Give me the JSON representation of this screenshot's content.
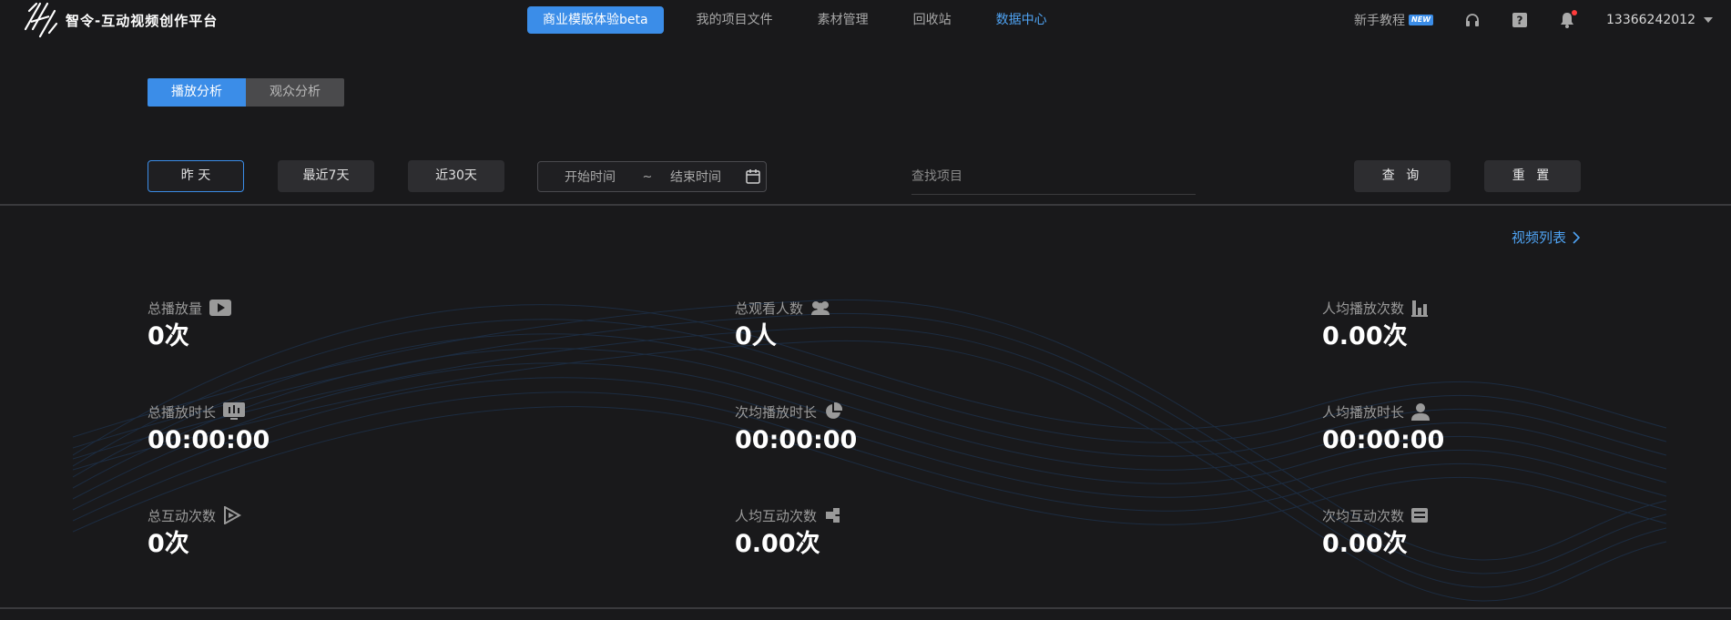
{
  "header": {
    "logo_text": "智令-互动视频创作平台",
    "nav_button": "商业模版体验beta",
    "nav_items": [
      "我的项目文件",
      "素材管理",
      "回收站",
      "数据中心"
    ],
    "tutorial_label": "新手教程",
    "new_badge": "NEW",
    "user_phone": "13366242012"
  },
  "tabs": [
    "播放分析",
    "观众分析"
  ],
  "filters": {
    "yesterday": "昨 天",
    "last7": "最近7天",
    "last30": "近30天",
    "start_placeholder": "开始时间",
    "range_sep": "~",
    "end_placeholder": "结束时间",
    "search_placeholder": "查找项目",
    "query": "查 询",
    "reset": "重 置"
  },
  "video_list_link": "视频列表",
  "metrics": [
    {
      "label": "总播放量",
      "value": "0次",
      "icon": "play-video-icon"
    },
    {
      "label": "总观看人数",
      "value": "0人",
      "icon": "group-users-icon"
    },
    {
      "label": "人均播放次数",
      "value": "0.00次",
      "icon": "bar-chart-icon"
    },
    {
      "label": "总播放时长",
      "value": "00:00:00",
      "icon": "screen-chart-icon"
    },
    {
      "label": "次均播放时长",
      "value": "00:00:00",
      "icon": "pie-chart-icon"
    },
    {
      "label": "人均播放时长",
      "value": "00:00:00",
      "icon": "user-icon"
    },
    {
      "label": "总互动次数",
      "value": "0次",
      "icon": "interaction-play-icon"
    },
    {
      "label": "人均互动次数",
      "value": "0.00次",
      "icon": "puzzle-icon"
    },
    {
      "label": "次均互动次数",
      "value": "0.00次",
      "icon": "list-card-icon"
    }
  ],
  "colors": {
    "accent": "#3b8de8",
    "link": "#4fa3f3",
    "background": "#19191b",
    "notification_dot": "#ff3b3b"
  }
}
